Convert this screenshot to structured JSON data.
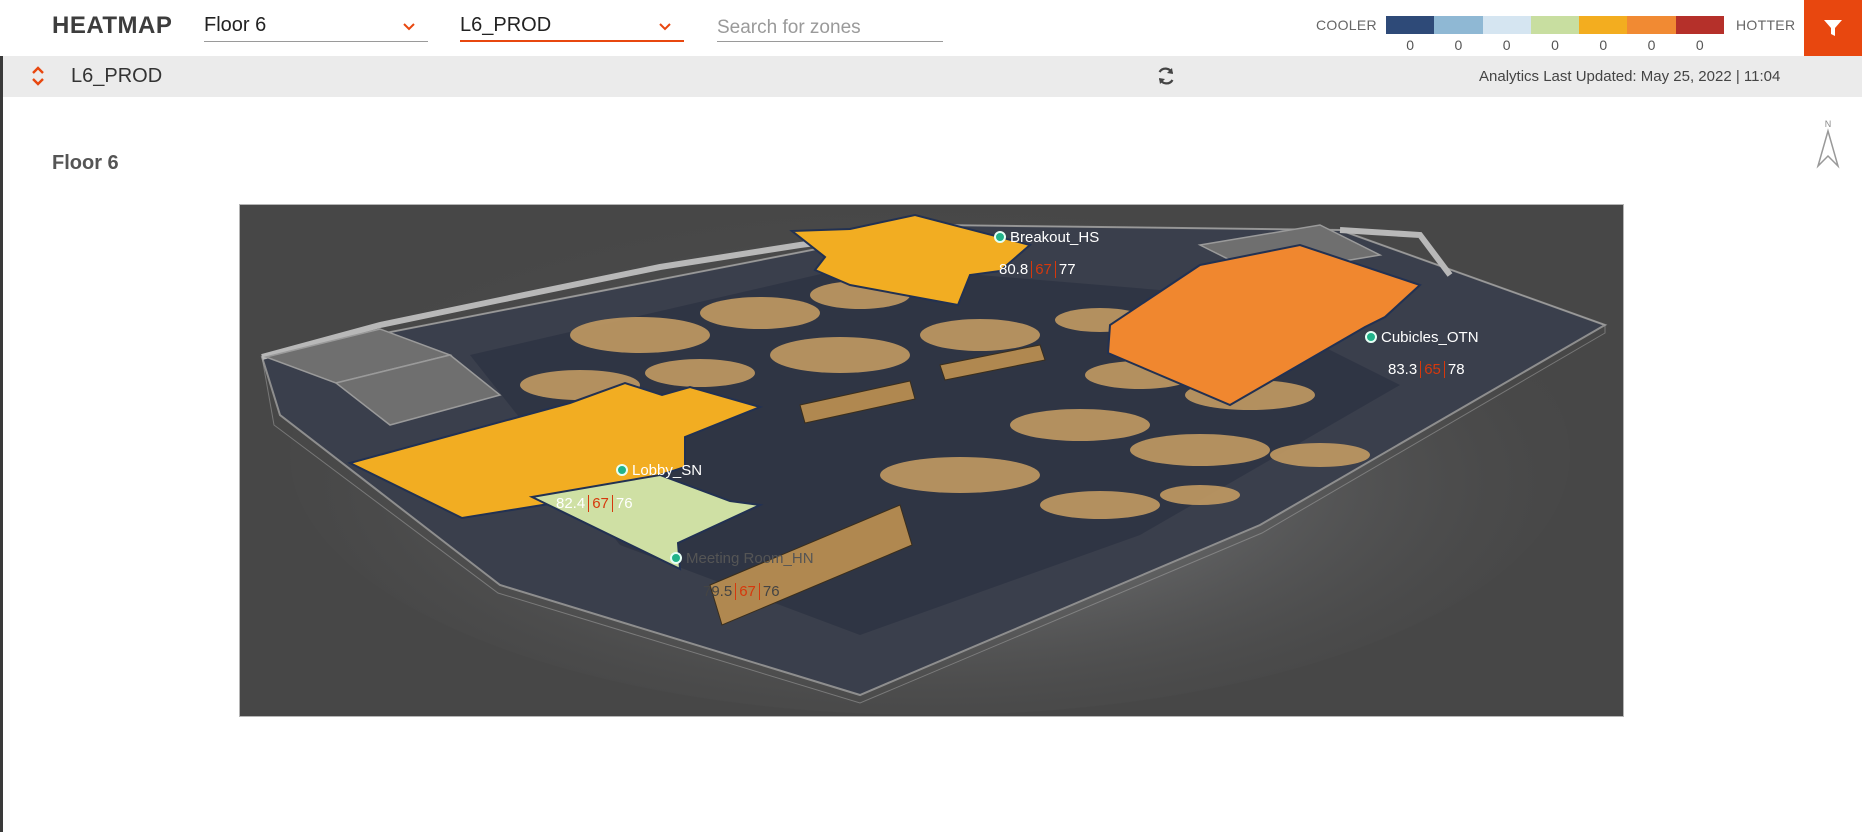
{
  "app": {
    "title": "HEATMAP"
  },
  "filters": {
    "floor": {
      "value": "Floor 6"
    },
    "site": {
      "value": "L6_PROD"
    },
    "search": {
      "placeholder": "Search for zones",
      "value": ""
    }
  },
  "legend": {
    "cooler_label": "COOLER",
    "hotter_label": "HOTTER",
    "bins": [
      {
        "color": "#2e4a78",
        "count": "0"
      },
      {
        "color": "#8fb8d4",
        "count": "0"
      },
      {
        "color": "#d5e5f1",
        "count": "0"
      },
      {
        "color": "#c8dea0",
        "count": "0"
      },
      {
        "color": "#f3ad1f",
        "count": "0"
      },
      {
        "color": "#f18a33",
        "count": "0"
      },
      {
        "color": "#b5302a",
        "count": "0"
      }
    ]
  },
  "filter_button": {
    "icon": "filter-icon",
    "color": "#e8470f"
  },
  "subbar": {
    "title": "L6_PROD",
    "updated_label": "Analytics Last Updated:",
    "updated_value": "May 25, 2022 | 11:04"
  },
  "content": {
    "floor_title": "Floor 6",
    "compass_label": "N"
  },
  "zones": [
    {
      "name": "Breakout_HS",
      "v1": "80.8",
      "v2": "67",
      "v3": "77",
      "color": "#f2ad22"
    },
    {
      "name": "Cubicles_OTN",
      "v1": "83.3",
      "v2": "65",
      "v3": "78",
      "color": "#f0872f"
    },
    {
      "name": "Lobby_SN",
      "v1": "82.4",
      "v2": "67",
      "v3": "76",
      "color": "#f2ad22"
    },
    {
      "name": "Meeting Room_HN",
      "v1": "79.5",
      "v2": "67",
      "v3": "76",
      "color": "#cfe0a4"
    }
  ]
}
